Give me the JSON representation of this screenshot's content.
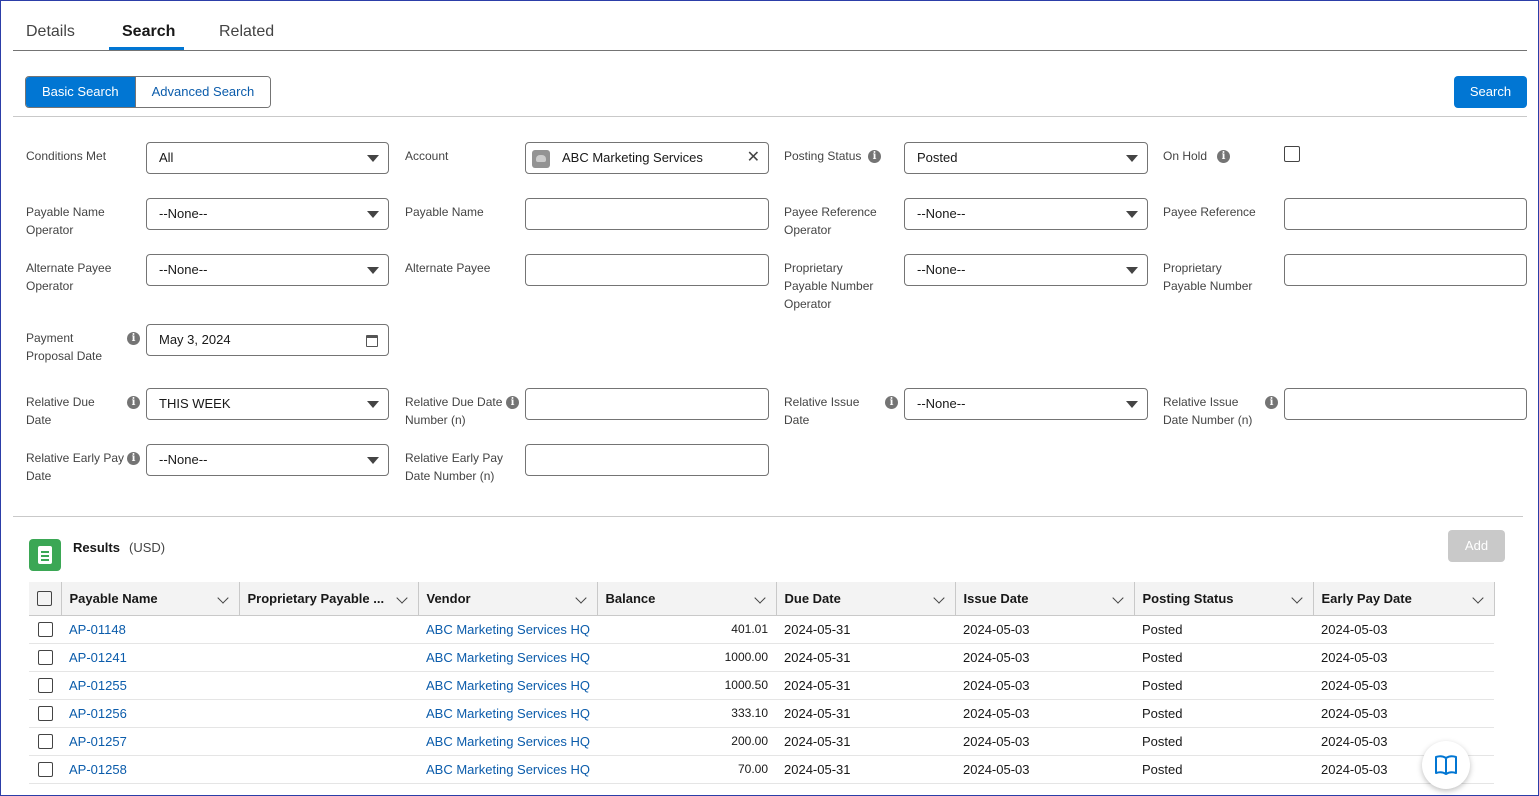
{
  "tabs": [
    {
      "label": "Details"
    },
    {
      "label": "Search"
    },
    {
      "label": "Related"
    }
  ],
  "search_mode": {
    "basic": "Basic Search",
    "advanced": "Advanced Search"
  },
  "search_button": "Search",
  "filters": {
    "conditions_met": {
      "label": "Conditions Met",
      "value": "All"
    },
    "account": {
      "label": "Account",
      "value": "ABC Marketing Services"
    },
    "posting_status": {
      "label": "Posting Status",
      "value": "Posted"
    },
    "on_hold": {
      "label": "On Hold",
      "checked": false
    },
    "payable_name_operator": {
      "label": "Payable Name Operator",
      "value": "--None--"
    },
    "payable_name": {
      "label": "Payable Name",
      "value": ""
    },
    "payee_reference_operator": {
      "label": "Payee Reference Operator",
      "value": "--None--"
    },
    "payee_reference": {
      "label": "Payee Reference",
      "value": ""
    },
    "alternate_payee_operator": {
      "label": "Alternate Payee Operator",
      "value": "--None--"
    },
    "alternate_payee": {
      "label": "Alternate Payee",
      "value": ""
    },
    "proprietary_payable_number_operator": {
      "label": "Proprietary Payable Number Operator",
      "value": "--None--"
    },
    "proprietary_payable_number": {
      "label": "Proprietary Payable Number",
      "value": ""
    },
    "payment_proposal_date": {
      "label": "Payment Proposal Date",
      "value": "May 3, 2024"
    },
    "relative_due_date": {
      "label": "Relative Due Date",
      "value": "THIS WEEK"
    },
    "relative_due_date_number": {
      "label": "Relative Due Date Number (n)",
      "value": ""
    },
    "relative_issue_date": {
      "label": "Relative Issue Date",
      "value": "--None--"
    },
    "relative_issue_date_number": {
      "label": "Relative Issue Date Number (n)",
      "value": ""
    },
    "relative_early_pay_date": {
      "label": "Relative Early Pay Date",
      "value": "--None--"
    },
    "relative_early_pay_date_number": {
      "label": "Relative Early Pay Date Number (n)",
      "value": ""
    }
  },
  "results": {
    "title": "Results",
    "currency": "(USD)",
    "add_button": "Add",
    "columns": [
      "Payable Name",
      "Proprietary Payable ...",
      "Vendor",
      "Balance",
      "Due Date",
      "Issue Date",
      "Posting Status",
      "Early Pay Date"
    ],
    "rows": [
      {
        "name": "AP-01148",
        "proprietary": "",
        "vendor": "ABC Marketing Services HQ",
        "balance": "401.01",
        "due": "2024-05-31",
        "issue": "2024-05-03",
        "status": "Posted",
        "early": "2024-05-03"
      },
      {
        "name": "AP-01241",
        "proprietary": "",
        "vendor": "ABC Marketing Services HQ",
        "balance": "1000.00",
        "due": "2024-05-31",
        "issue": "2024-05-03",
        "status": "Posted",
        "early": "2024-05-03"
      },
      {
        "name": "AP-01255",
        "proprietary": "",
        "vendor": "ABC Marketing Services HQ",
        "balance": "1000.50",
        "due": "2024-05-31",
        "issue": "2024-05-03",
        "status": "Posted",
        "early": "2024-05-03"
      },
      {
        "name": "AP-01256",
        "proprietary": "",
        "vendor": "ABC Marketing Services HQ",
        "balance": "333.10",
        "due": "2024-05-31",
        "issue": "2024-05-03",
        "status": "Posted",
        "early": "2024-05-03"
      },
      {
        "name": "AP-01257",
        "proprietary": "",
        "vendor": "ABC Marketing Services HQ",
        "balance": "200.00",
        "due": "2024-05-31",
        "issue": "2024-05-03",
        "status": "Posted",
        "early": "2024-05-03"
      },
      {
        "name": "AP-01258",
        "proprietary": "",
        "vendor": "ABC Marketing Services HQ",
        "balance": "70.00",
        "due": "2024-05-31",
        "issue": "2024-05-03",
        "status": "Posted",
        "early": "2024-05-03"
      }
    ]
  },
  "colors": {
    "brand": "#0176d3",
    "link": "#0b5cab",
    "results_icon": "#3ba755"
  },
  "icons": {
    "info": "info-icon",
    "help": "book-open-icon",
    "calendar": "calendar-icon"
  }
}
